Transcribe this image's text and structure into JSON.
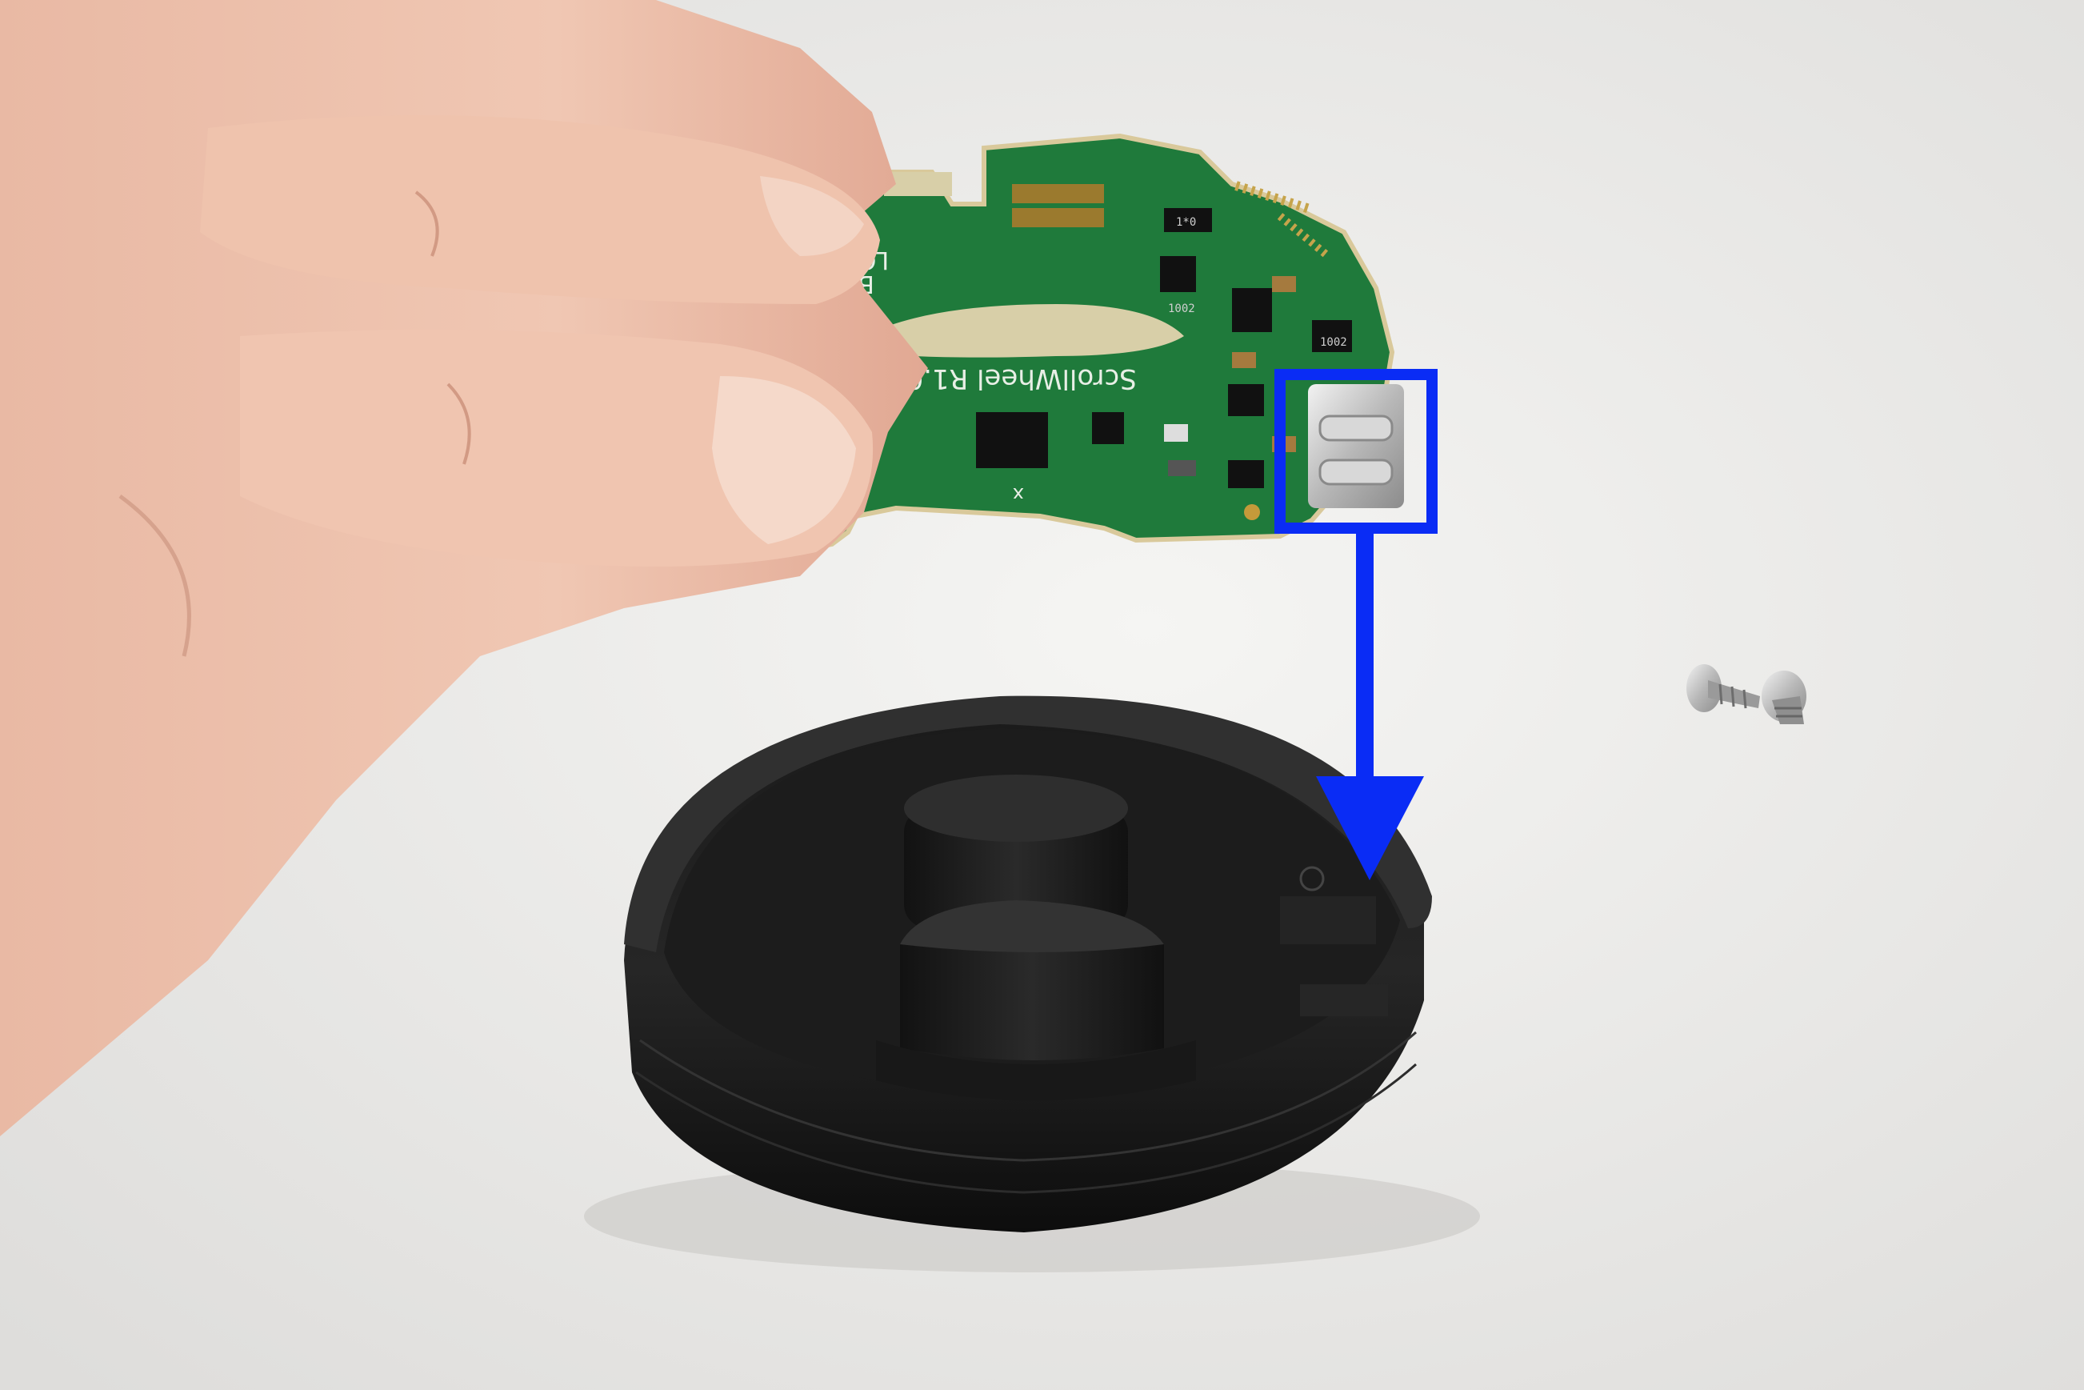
{
  "scene": {
    "pcb": {
      "model_label": "ScrollWheel R1.001",
      "bootloader_label_line1": "BOOT",
      "bootloader_label_line2": "LOADER",
      "chip_marking_1": "1002",
      "chip_marking_2": "1002",
      "chip_marking_3": "1*0",
      "pin1_mark": "x"
    },
    "annotation": {
      "highlight_color": "#0a2cf5",
      "highlight_target": "usb-c-connector",
      "arrow_direction": "down"
    },
    "objects": [
      "hand",
      "pcb",
      "black-enclosure-base",
      "screws"
    ]
  }
}
